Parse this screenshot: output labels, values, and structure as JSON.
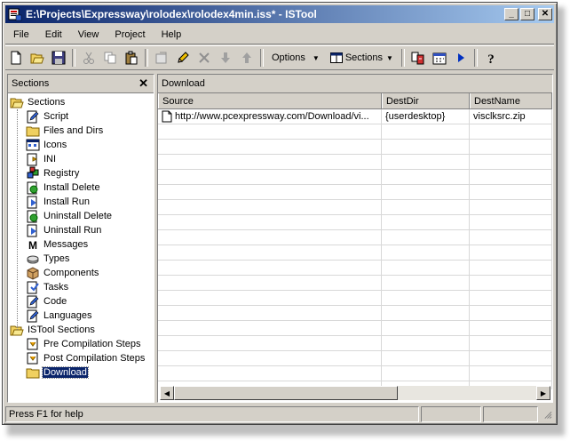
{
  "window": {
    "title": "E:\\Projects\\Expressway\\rolodex\\rolodex4min.iss* - ISTool",
    "minimize_label": "_",
    "maximize_label": "□",
    "close_label": "✕"
  },
  "menu": [
    "File",
    "Edit",
    "View",
    "Project",
    "Help"
  ],
  "toolbar": {
    "options_label": "Options",
    "sections_label": "Sections",
    "dropdown_glyph": "▼"
  },
  "sections_panel": {
    "title": "Sections",
    "close_glyph": "✕",
    "groups": [
      {
        "label": "Sections",
        "items": [
          "Script",
          "Files and Dirs",
          "Icons",
          "INI",
          "Registry",
          "Install Delete",
          "Install Run",
          "Uninstall Delete",
          "Uninstall Run",
          "Messages",
          "Types",
          "Components",
          "Tasks",
          "Code",
          "Languages"
        ]
      },
      {
        "label": "ISTool Sections",
        "items": [
          "Pre Compilation Steps",
          "Post Compilation Steps",
          "Download"
        ]
      }
    ],
    "selected": "Download"
  },
  "main_panel": {
    "title": "Download",
    "columns": [
      "Source",
      "DestDir",
      "DestName"
    ],
    "rows": [
      [
        "http://www.pcexpressway.com/Download/vi...",
        "{userdesktop}",
        "visclksrc.zip"
      ]
    ]
  },
  "statusbar": {
    "text": "Press F1 for help"
  },
  "colors": {
    "title_gradient_start": "#0a246a",
    "title_gradient_end": "#a6caf0",
    "face": "#d4d0c8",
    "selection": "#0a246a"
  }
}
